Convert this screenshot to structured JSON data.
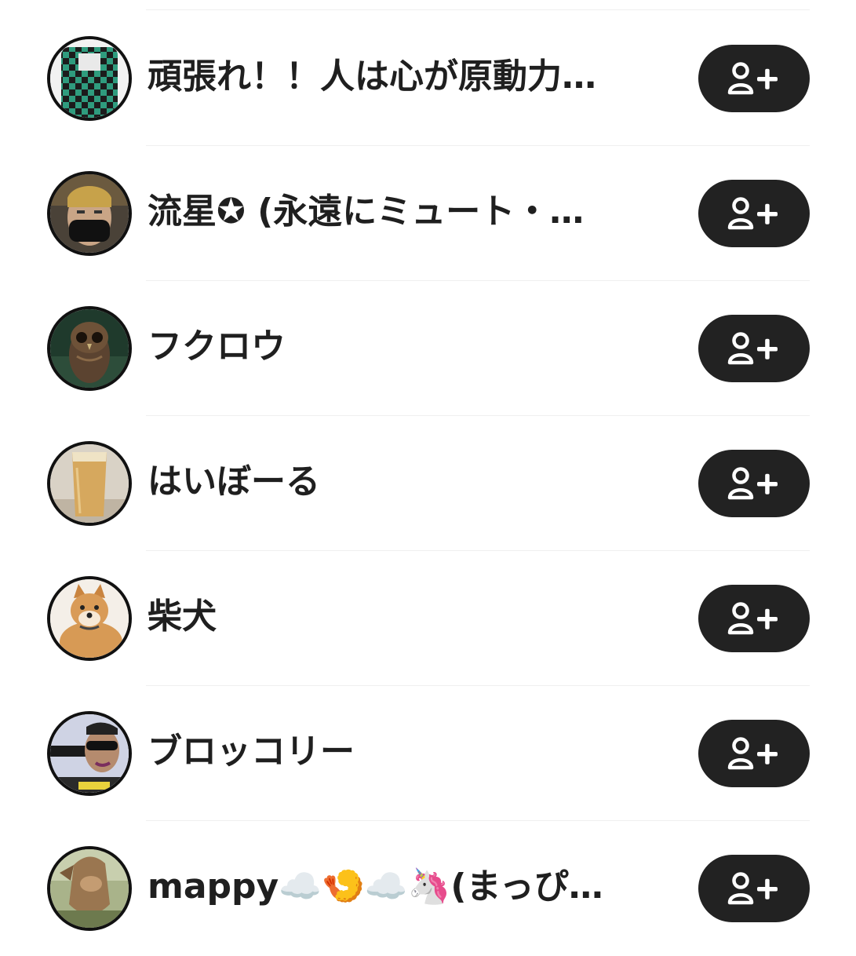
{
  "users": [
    {
      "name": "頑張れ！！人は心が原動力…",
      "avatar_icon": "checkered-hoodie-avatar",
      "follow_icon": "add-user-icon"
    },
    {
      "name": "流星✪ (永遠にミュート・…",
      "avatar_icon": "masked-man-avatar",
      "follow_icon": "add-user-icon"
    },
    {
      "name": "フクロウ",
      "avatar_icon": "owl-avatar",
      "follow_icon": "add-user-icon"
    },
    {
      "name": "はいぼーる",
      "avatar_icon": "highball-glass-avatar",
      "follow_icon": "add-user-icon"
    },
    {
      "name": "柴犬",
      "avatar_icon": "shiba-dog-avatar",
      "follow_icon": "add-user-icon"
    },
    {
      "name": "ブロッコリー",
      "avatar_icon": "sunglasses-man-avatar",
      "follow_icon": "add-user-icon"
    },
    {
      "name": "mappy☁️🍤☁️🦄(まっぴ…",
      "avatar_icon": "animal-statue-avatar",
      "follow_icon": "add-user-icon"
    }
  ],
  "colors": {
    "button_bg": "#222222",
    "button_icon": "#ffffff",
    "avatar_border": "#111111",
    "divider": "#efefef",
    "text": "#1f1f1f"
  }
}
